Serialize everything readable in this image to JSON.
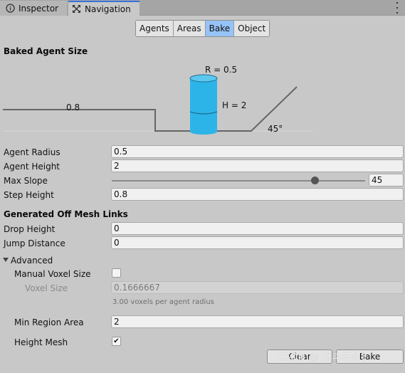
{
  "tabs": [
    {
      "label": "Inspector",
      "icon": "info-icon",
      "active": false
    },
    {
      "label": "Navigation",
      "icon": "navigation-icon",
      "active": true
    }
  ],
  "segments": [
    "Agents",
    "Areas",
    "Bake",
    "Object"
  ],
  "selected_segment": "Bake",
  "baked_agent_size": {
    "heading": "Baked Agent Size",
    "radius_label": "R = 0.5",
    "height_label": "H = 2",
    "step_label": "0.8",
    "slope_label": "45°"
  },
  "agent": {
    "radius_label": "Agent Radius",
    "radius_value": "0.5",
    "height_label": "Agent Height",
    "height_value": "2",
    "slope_label": "Max Slope",
    "slope_value": "45",
    "slope_fraction": 0.8,
    "step_label": "Step Height",
    "step_value": "0.8"
  },
  "offmesh": {
    "heading": "Generated Off Mesh Links",
    "drop_label": "Drop Height",
    "drop_value": "0",
    "jump_label": "Jump Distance",
    "jump_value": "0"
  },
  "advanced": {
    "label": "Advanced",
    "manual_voxel_label": "Manual Voxel Size",
    "manual_voxel_checked": false,
    "voxel_size_label": "Voxel Size",
    "voxel_size_value": "0.1666667",
    "voxel_hint": "3.00 voxels per agent radius",
    "min_region_label": "Min Region Area",
    "min_region_value": "2",
    "height_mesh_label": "Height Mesh",
    "height_mesh_checked": true
  },
  "buttons": {
    "clear": "Clear",
    "bake": "Bake"
  },
  "watermark": "CSDN @[奋斗不止]",
  "colors": {
    "accent": "#3a72d8",
    "selected_segment": "#96c3f7",
    "cylinder": "#2cb4e8"
  }
}
